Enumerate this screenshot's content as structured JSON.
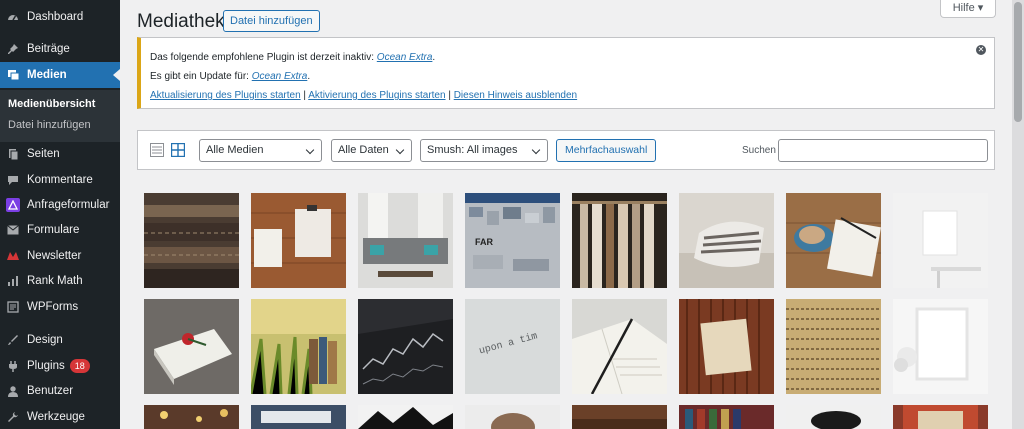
{
  "sidebar": {
    "items": [
      {
        "label": "Dashboard",
        "icon": "dashboard-icon"
      },
      {
        "label": "Beiträge",
        "icon": "pin-icon"
      },
      {
        "label": "Medien",
        "icon": "media-icon"
      },
      {
        "label": "Seiten",
        "icon": "pages-icon"
      },
      {
        "label": "Kommentare",
        "icon": "comments-icon"
      },
      {
        "label": "Anfrageformular",
        "icon": "form-icon"
      },
      {
        "label": "Formulare",
        "icon": "mail-icon"
      },
      {
        "label": "Newsletter",
        "icon": "newsletter-icon"
      },
      {
        "label": "Rank Math",
        "icon": "chart-icon"
      },
      {
        "label": "WPForms",
        "icon": "wpforms-icon"
      },
      {
        "label": "Design",
        "icon": "brush-icon"
      },
      {
        "label": "Plugins",
        "icon": "plugin-icon"
      },
      {
        "label": "Benutzer",
        "icon": "user-icon"
      },
      {
        "label": "Werkzeuge",
        "icon": "wrench-icon"
      }
    ],
    "submenu": [
      "Medienübersicht",
      "Datei hinzufügen"
    ],
    "plugins_badge": "18"
  },
  "header": {
    "title": "Mediathek",
    "add_file": "Datei hinzufügen",
    "help": "Hilfe ▾"
  },
  "notice": {
    "line1_text": "Das folgende empfohlene Plugin ist derzeit inaktiv: ",
    "line1_link": "Ocean Extra",
    "line1_end": ".",
    "line2_text": "Es gibt ein Update für: ",
    "line2_link": "Ocean Extra",
    "line2_end": ".",
    "link_update": "Aktualisierung des Plugins starten",
    "link_activate": "Aktivierung des Plugins starten",
    "link_dismiss": "Diesen Hinweis ausblenden",
    "separator": " | "
  },
  "toolbar": {
    "filter_media": "Alle Medien",
    "filter_dates": "Alle Daten",
    "filter_smush": "Smush: All images",
    "bulk_select": "Mehrfachauswahl",
    "search_label": "Suchen"
  },
  "colors": {
    "sidebar_bg": "#1d2327",
    "accent": "#2271b1",
    "notice_border": "#dba617",
    "badge": "#d63638"
  }
}
